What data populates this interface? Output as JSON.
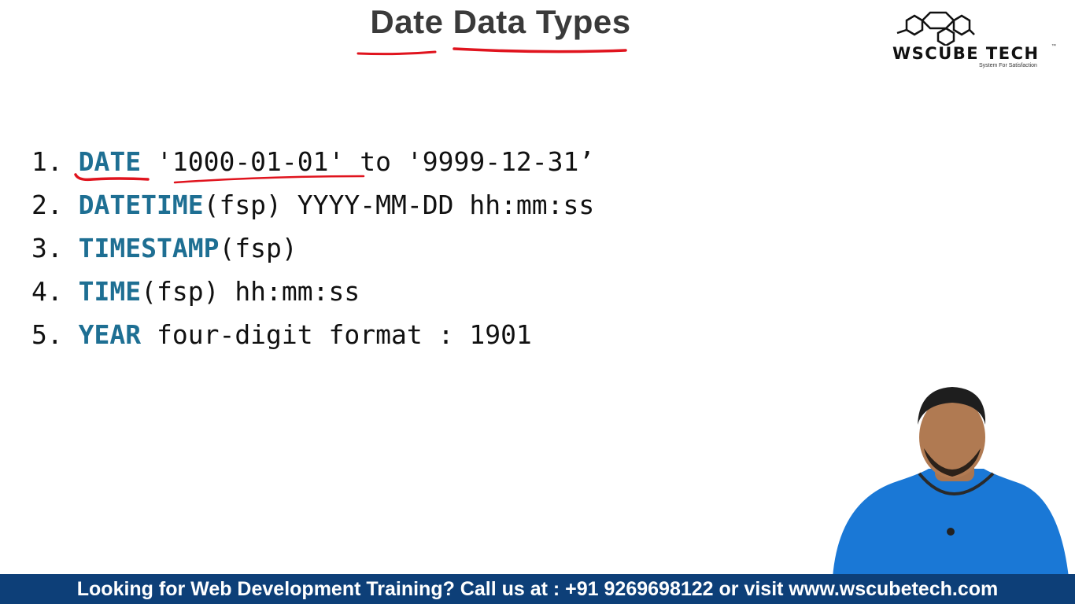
{
  "slide": {
    "title": "Date Data Types",
    "items": [
      {
        "number": "1.",
        "keyword": "DATE",
        "rest": " '1000-01-01' to '9999-12-31’"
      },
      {
        "number": "2.",
        "keyword": "DATETIME",
        "rest": "(fsp) YYYY-MM-DD hh:mm:ss"
      },
      {
        "number": "3.",
        "keyword": "TIMESTAMP",
        "rest": "(fsp)"
      },
      {
        "number": "4.",
        "keyword": "TIME",
        "rest": "(fsp) hh:mm:ss"
      },
      {
        "number": "5.",
        "keyword": "YEAR",
        "rest": " four-digit format : 1901"
      }
    ]
  },
  "logo": {
    "name": "WsCube Tech",
    "tagline": "System For Satisfaction",
    "trademark": "™"
  },
  "banner": {
    "text": "Looking for Web Development Training? Call us at : +91 9269698122 or visit www.wscubetech.com"
  },
  "colors": {
    "keyword": "#1e6f93",
    "annotation": "#e0141e",
    "banner": "#0d3f78",
    "shirt": "#1a78d6"
  }
}
